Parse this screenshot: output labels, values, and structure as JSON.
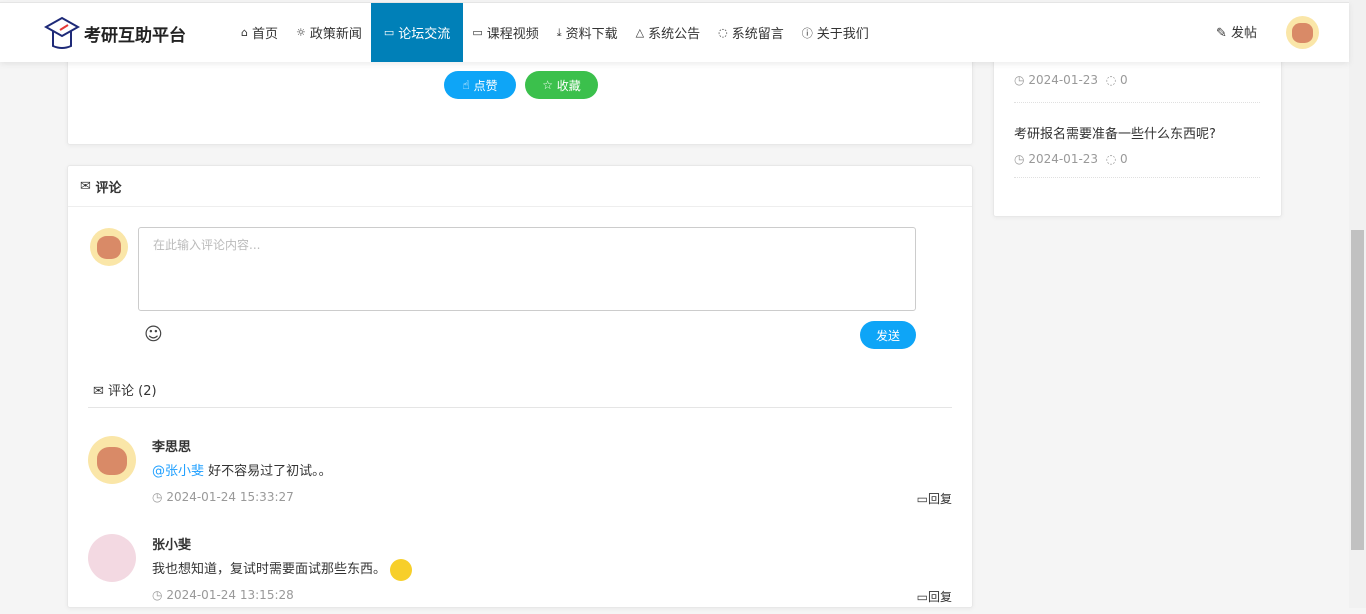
{
  "brand": {
    "title": "考研互助平台"
  },
  "nav": [
    {
      "label": "首页",
      "icon": "home-icon",
      "glyph": "⌂"
    },
    {
      "label": "政策新闻",
      "icon": "sun-icon",
      "glyph": "☼"
    },
    {
      "label": "论坛交流",
      "icon": "message-icon",
      "glyph": "▭"
    },
    {
      "label": "课程视频",
      "icon": "video-icon",
      "glyph": "▭"
    },
    {
      "label": "资料下载",
      "icon": "download-icon",
      "glyph": "⤓"
    },
    {
      "label": "系统公告",
      "icon": "bell-icon",
      "glyph": "♫"
    },
    {
      "label": "系统留言",
      "icon": "chat-icon",
      "glyph": "◌"
    },
    {
      "label": "关于我们",
      "icon": "info-icon",
      "glyph": "ⓘ"
    }
  ],
  "header": {
    "post_label": "发帖"
  },
  "post_actions": {
    "like": "点赞",
    "favorite": "收藏"
  },
  "comments_card": {
    "title": "评论",
    "placeholder": "在此输入评论内容...",
    "send": "发送",
    "count_label": "评论 (2)"
  },
  "comments": [
    {
      "name": "李思思",
      "mention": "@张小斐",
      "text": " 好不容易过了初试。。",
      "time": "2024-01-24 15:33:27",
      "reply": "回复"
    },
    {
      "name": "张小斐",
      "mention": "",
      "text": "我也想知道，复试时需要面试那些东西。",
      "time": "2024-01-24 13:15:28",
      "reply": "回复"
    }
  ],
  "sidebar": {
    "items": [
      {
        "date": "2024-01-23",
        "count": "0"
      },
      {
        "title": "考研报名需要准备一些什么东西呢?",
        "date": "2024-01-23",
        "count": "0"
      }
    ]
  },
  "colors": {
    "accent": "#0080b8",
    "like": "#0ea5f7",
    "favorite": "#3bc04c"
  }
}
